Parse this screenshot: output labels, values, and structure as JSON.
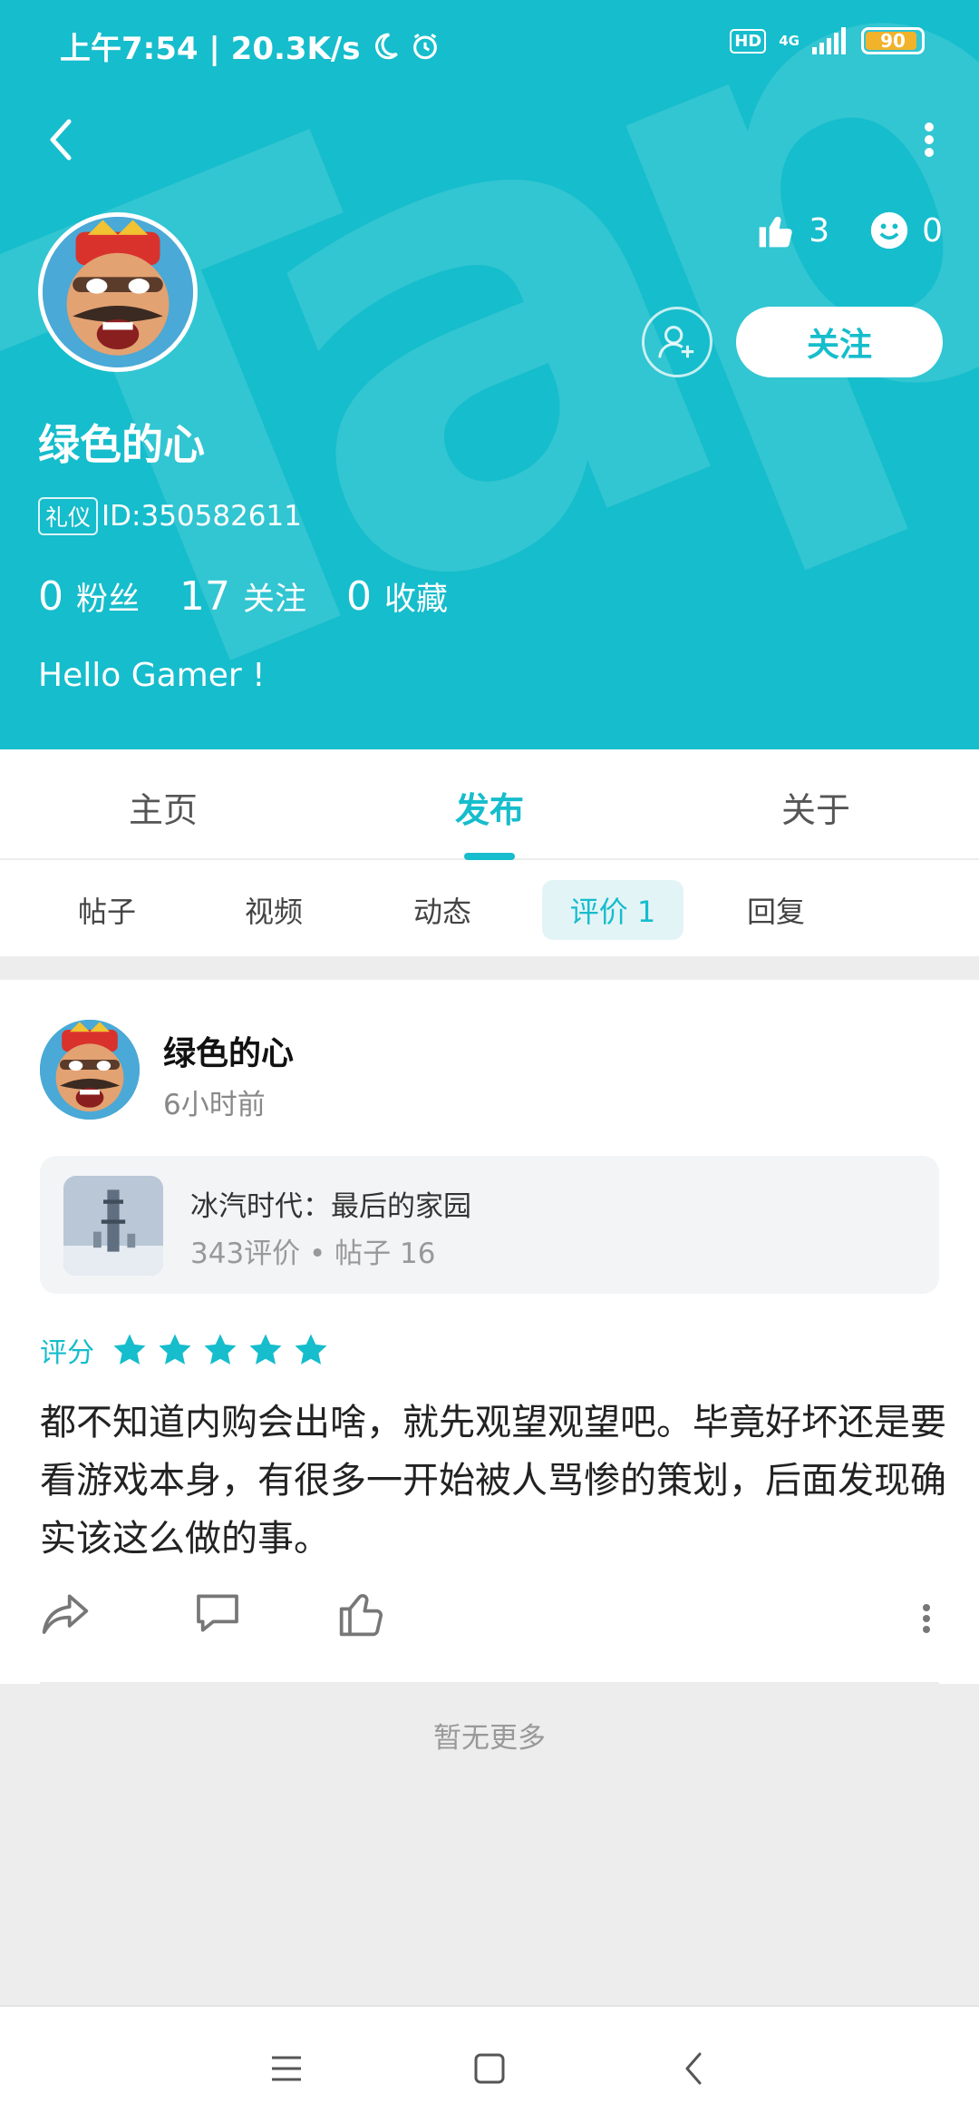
{
  "status_bar": {
    "time_speed": "上午7:54 | 20.3K/s",
    "hd": "HD",
    "network": "4G",
    "battery": "90"
  },
  "profile": {
    "username": "绿色的心",
    "tag": "礼仪",
    "id": "ID:350582611",
    "likes": "3",
    "smiles": "0",
    "follow_label": "关注",
    "fans_count": "0",
    "fans_label": "粉丝",
    "following_count": "17",
    "following_label": "关注",
    "fav_count": "0",
    "fav_label": "收藏",
    "bio": "Hello Gamer !"
  },
  "tabs": [
    "主页",
    "发布",
    "关于"
  ],
  "active_tab": "发布",
  "subtabs": [
    "帖子",
    "视频",
    "动态",
    "评价 1",
    "回复"
  ],
  "active_subtab": "评价 1",
  "post": {
    "author": "绿色的心",
    "time": "6小时前",
    "game": {
      "title": "冰汽时代：最后的家园",
      "meta": "343评价 • 帖子 16"
    },
    "rating_label": "评分",
    "stars": 5,
    "text": "都不知道内购会出啥，就先观望观望吧。毕竟好坏还是要看游戏本身，有很多一开始被人骂惨的策划，后面发现确实该这么做的事。"
  },
  "no_more": "暂无更多",
  "colors": {
    "accent": "#16bdcc",
    "battery": "#f2b22a"
  }
}
